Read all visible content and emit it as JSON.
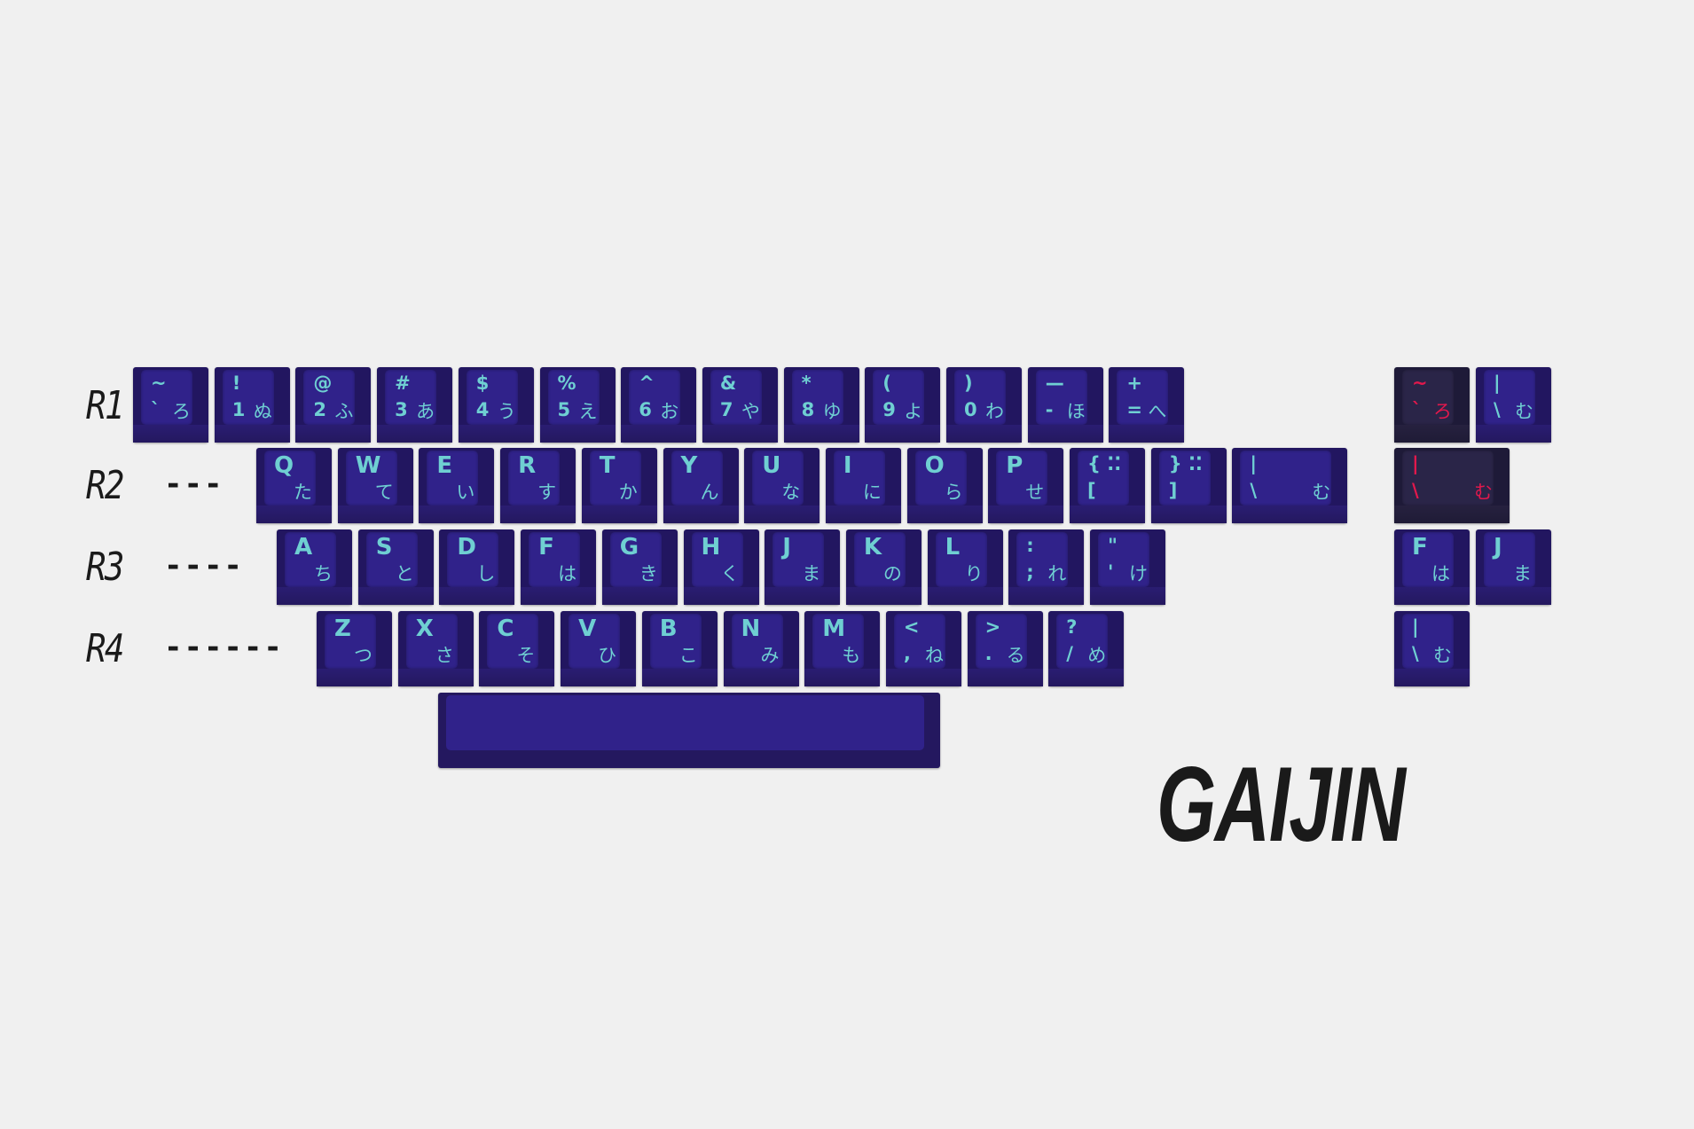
{
  "brand": "GAIJIN",
  "row_labels": [
    {
      "label": "R1",
      "dashes": ""
    },
    {
      "label": "R2",
      "dashes": "---"
    },
    {
      "label": "R3",
      "dashes": "----"
    },
    {
      "label": "R4",
      "dashes": "------"
    }
  ],
  "colors": {
    "background": "#f0f0f0",
    "keycap": "#30228a",
    "legend": "#6fcfd2",
    "dark_keycap": "#2a2548",
    "accent_red": "#e2184c"
  },
  "rows": [
    [
      {
        "t": "~",
        "bl": "`",
        "br": "ろ"
      },
      {
        "t": "!",
        "bl": "1",
        "br": "ぬ"
      },
      {
        "t": "@",
        "bl": "2",
        "br": "ふ"
      },
      {
        "t": "#",
        "bl": "3",
        "br": "あ"
      },
      {
        "t": "$",
        "bl": "4",
        "br": "う"
      },
      {
        "t": "%",
        "bl": "5",
        "br": "え"
      },
      {
        "t": "^",
        "bl": "6",
        "br": "お"
      },
      {
        "t": "&",
        "bl": "7",
        "br": "や"
      },
      {
        "t": "*",
        "bl": "8",
        "br": "ゆ"
      },
      {
        "t": "(",
        "bl": "9",
        "br": "よ"
      },
      {
        "t": ")",
        "bl": "0",
        "br": "わ"
      },
      {
        "t": "—",
        "bl": "-",
        "br": "ほ"
      },
      {
        "t": "+",
        "bl": "=",
        "br": "へ"
      }
    ],
    [
      {
        "t": "Q",
        "br": "た"
      },
      {
        "t": "W",
        "br": "て"
      },
      {
        "t": "E",
        "br": "い"
      },
      {
        "t": "R",
        "br": "す"
      },
      {
        "t": "T",
        "br": "か"
      },
      {
        "t": "Y",
        "br": "ん"
      },
      {
        "t": "U",
        "br": "な"
      },
      {
        "t": "I",
        "br": "に"
      },
      {
        "t": "O",
        "br": "ら"
      },
      {
        "t": "P",
        "br": "せ"
      },
      {
        "t": "{ ⁚⁚",
        "bl": "["
      },
      {
        "t": "} ⁚⁚",
        "bl": "]"
      },
      {
        "t": "|",
        "bl": "\\",
        "br": "む"
      }
    ],
    [
      {
        "t": "A",
        "br": "ち"
      },
      {
        "t": "S",
        "br": "と"
      },
      {
        "t": "D",
        "br": "し"
      },
      {
        "t": "F",
        "br": "は"
      },
      {
        "t": "G",
        "br": "き"
      },
      {
        "t": "H",
        "br": "く"
      },
      {
        "t": "J",
        "br": "ま"
      },
      {
        "t": "K",
        "br": "の"
      },
      {
        "t": "L",
        "br": "り"
      },
      {
        "t": ":",
        "bl": ";",
        "br": "れ"
      },
      {
        "t": "\"",
        "bl": "'",
        "br": "け"
      }
    ],
    [
      {
        "t": "Z",
        "br": "つ"
      },
      {
        "t": "X",
        "br": "さ"
      },
      {
        "t": "C",
        "br": "そ"
      },
      {
        "t": "V",
        "br": "ひ"
      },
      {
        "t": "B",
        "br": "こ"
      },
      {
        "t": "N",
        "br": "み"
      },
      {
        "t": "M",
        "br": "も"
      },
      {
        "t": "<",
        "bl": ",",
        "br": "ね"
      },
      {
        "t": ">",
        "bl": ".",
        "br": "る"
      },
      {
        "t": "?",
        "bl": "/",
        "br": "め"
      }
    ]
  ],
  "extras": [
    {
      "t": "~",
      "bl": "`",
      "br": "ろ"
    },
    {
      "t": "|",
      "bl": "\\",
      "br": "む"
    },
    {
      "t": "|",
      "bl": "\\",
      "br": "む"
    },
    {
      "t": "F",
      "br": "は"
    },
    {
      "t": "J",
      "br": "ま"
    },
    {
      "t": "|",
      "bl": "\\",
      "br": "む"
    }
  ]
}
